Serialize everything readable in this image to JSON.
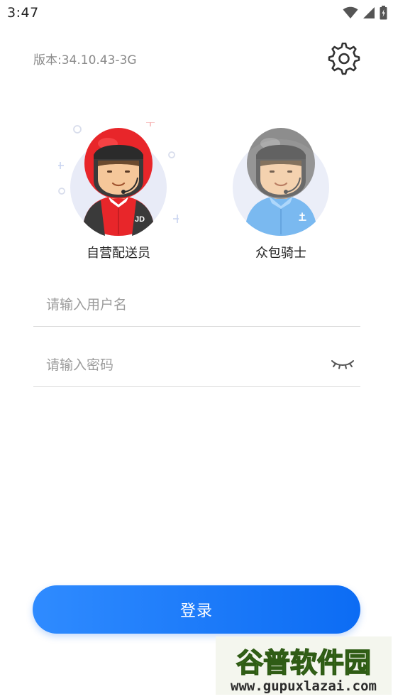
{
  "status_bar": {
    "time": "3:47"
  },
  "header": {
    "version": "版本:34.10.43-3G"
  },
  "roles": [
    {
      "label": "自营配送员",
      "badge": "JD"
    },
    {
      "label": "众包骑士"
    }
  ],
  "form": {
    "username_placeholder": "请输入用户名",
    "password_placeholder": "请输入密码"
  },
  "login": {
    "label": "登录"
  },
  "watermark": {
    "title": "谷普软件园",
    "url": "www.gupuxlazai.com"
  },
  "colors": {
    "accent": "#1a7af8",
    "self_helmet": "#e8262a",
    "crowd_helmet": "#8d8d8d",
    "crowd_shirt": "#6fb3ef"
  },
  "icons": {
    "settings": "gear-icon",
    "password_toggle": "eye-closed-icon"
  }
}
